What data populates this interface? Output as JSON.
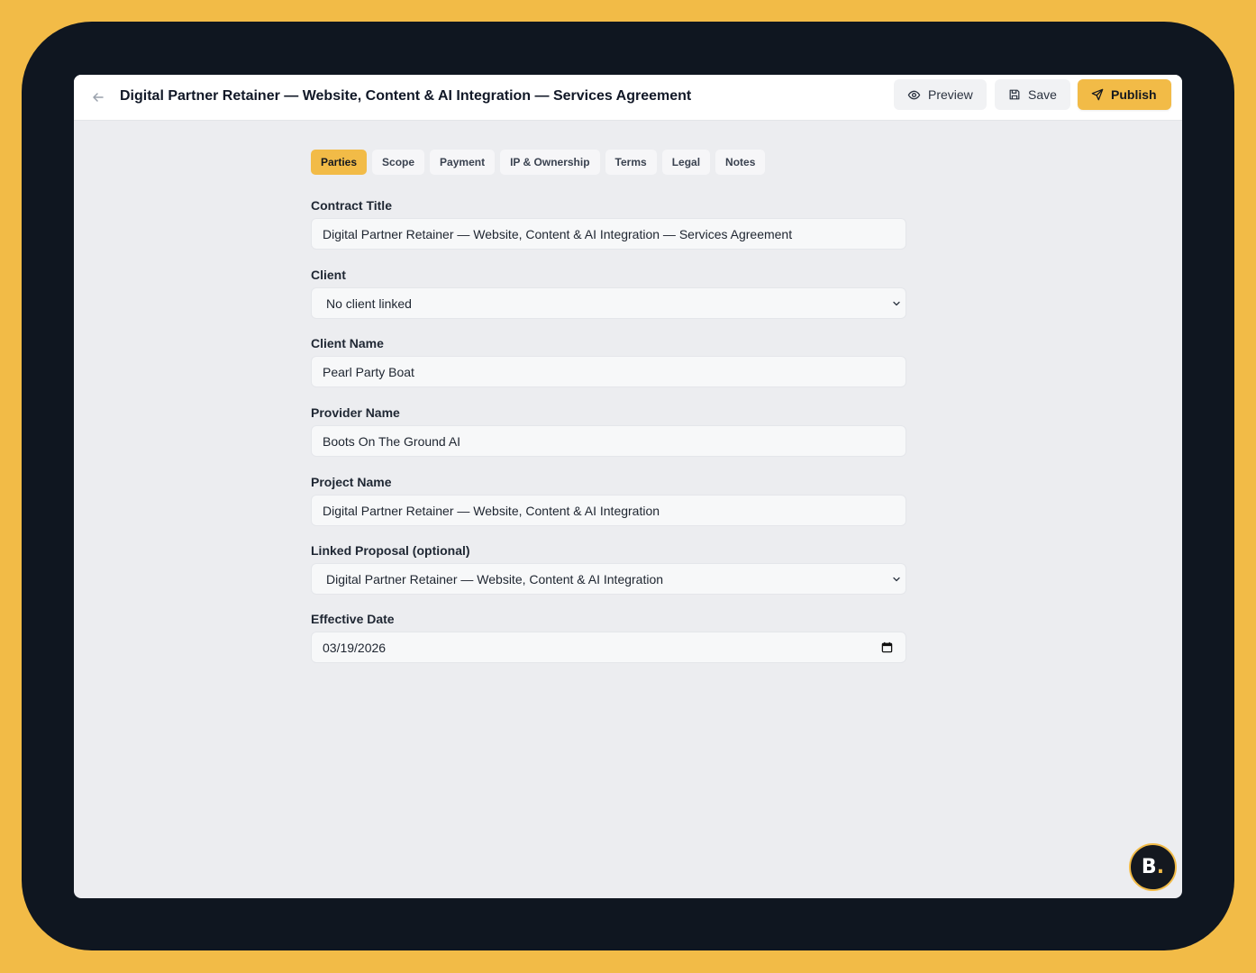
{
  "header": {
    "title": "Digital Partner Retainer — Website, Content & AI Integration — Services Agreement",
    "preview_label": "Preview",
    "save_label": "Save",
    "publish_label": "Publish"
  },
  "tabs": [
    {
      "label": "Parties",
      "active": true
    },
    {
      "label": "Scope",
      "active": false
    },
    {
      "label": "Payment",
      "active": false
    },
    {
      "label": "IP & Ownership",
      "active": false
    },
    {
      "label": "Terms",
      "active": false
    },
    {
      "label": "Legal",
      "active": false
    },
    {
      "label": "Notes",
      "active": false
    }
  ],
  "form": {
    "contract_title": {
      "label": "Contract Title",
      "value": "Digital Partner Retainer — Website, Content & AI Integration — Services Agreement"
    },
    "client": {
      "label": "Client",
      "value": "No client linked"
    },
    "client_name": {
      "label": "Client Name",
      "value": "Pearl Party Boat"
    },
    "provider_name": {
      "label": "Provider Name",
      "value": "Boots On The Ground AI"
    },
    "project_name": {
      "label": "Project Name",
      "value": "Digital Partner Retainer — Website, Content & AI Integration"
    },
    "linked_proposal": {
      "label": "Linked Proposal (optional)",
      "value": "Digital Partner Retainer — Website, Content & AI Integration"
    },
    "effective_date": {
      "label": "Effective Date",
      "value": "03/19/2026"
    }
  },
  "avatar": {
    "letter": "B",
    "dot": "."
  },
  "colors": {
    "accent": "#F2BB47",
    "frame": "#0F1620",
    "canvas": "#ECEDF0"
  },
  "icons": {
    "back": "arrow-left-icon",
    "preview": "eye-icon",
    "save": "floppy-disk-icon",
    "publish": "send-icon",
    "select": "chevron-down-icon",
    "date": "calendar-icon"
  }
}
